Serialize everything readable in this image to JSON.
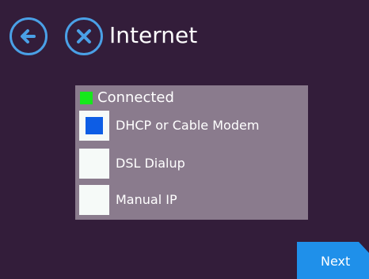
{
  "header": {
    "title": "Internet",
    "back_icon": "arrow-left-icon",
    "cancel_icon": "close-icon"
  },
  "status": {
    "label": "Connected",
    "color": "#15e81b"
  },
  "options": [
    {
      "label": "DHCP or Cable Modem",
      "selected": true
    },
    {
      "label": "DSL Dialup",
      "selected": false
    },
    {
      "label": "Manual IP",
      "selected": false
    }
  ],
  "footer": {
    "next_label": "Next"
  },
  "colors": {
    "background": "#331d3a",
    "panel": "#8a7b8d",
    "accent": "#4aa0e6",
    "selected": "#0d5de5",
    "next_button": "#1f90ea"
  }
}
